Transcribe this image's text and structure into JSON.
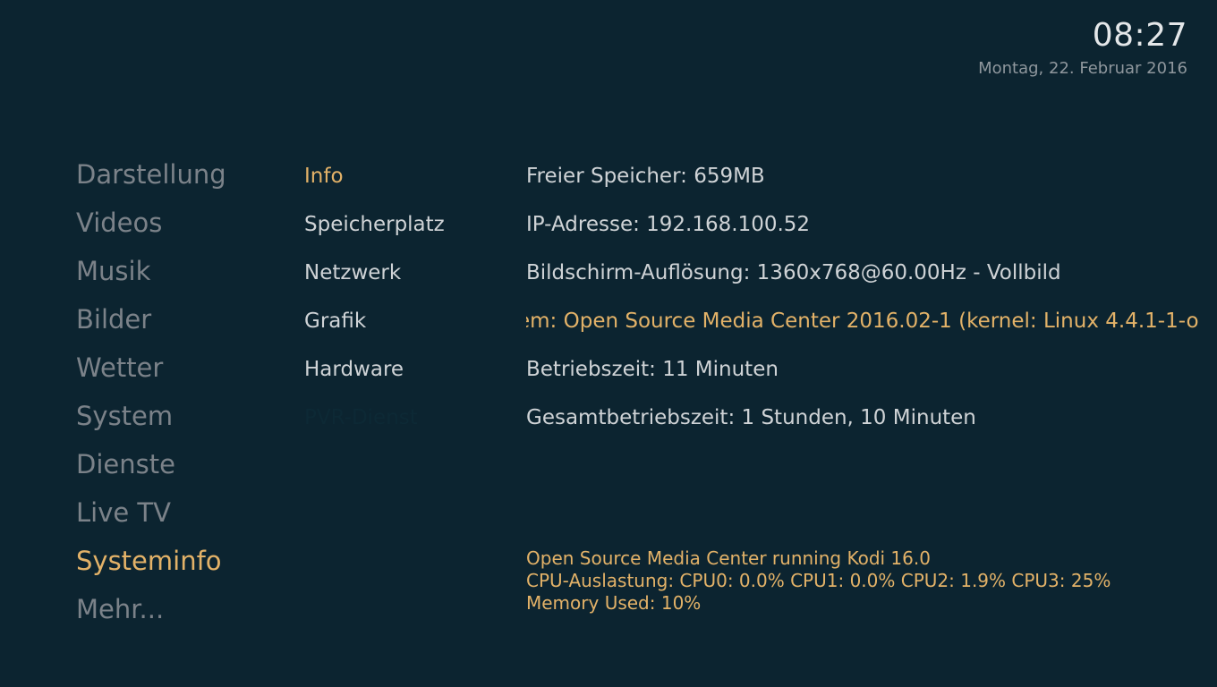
{
  "clock": {
    "time": "08:27",
    "date": "Montag, 22. Februar 2016"
  },
  "colors": {
    "background": "#0c2430",
    "accent": "#e3b268",
    "menu_text": "#7b8289",
    "info_text": "#cfd3d6",
    "disabled_text": "#0d2935",
    "date_text": "#8f979d",
    "time_text": "#e4e7e9"
  },
  "sidebar": {
    "items": [
      {
        "label": "Darstellung",
        "selected": false
      },
      {
        "label": "Videos",
        "selected": false
      },
      {
        "label": "Musik",
        "selected": false
      },
      {
        "label": "Bilder",
        "selected": false
      },
      {
        "label": "Wetter",
        "selected": false
      },
      {
        "label": "System",
        "selected": false
      },
      {
        "label": "Dienste",
        "selected": false
      },
      {
        "label": "Live TV",
        "selected": false
      },
      {
        "label": "Systeminfo",
        "selected": true
      },
      {
        "label": "Mehr...",
        "selected": false
      }
    ]
  },
  "subcategories": {
    "items": [
      {
        "label": "Info",
        "selected": true,
        "disabled": false
      },
      {
        "label": "Speicherplatz",
        "selected": false,
        "disabled": false
      },
      {
        "label": "Netzwerk",
        "selected": false,
        "disabled": false
      },
      {
        "label": "Grafik",
        "selected": false,
        "disabled": false
      },
      {
        "label": "Hardware",
        "selected": false,
        "disabled": false
      },
      {
        "label": "PVR-Dienst",
        "selected": false,
        "disabled": true
      }
    ]
  },
  "info_panel": {
    "rows": [
      {
        "text": "Freier Speicher: 659MB",
        "scrolling": false
      },
      {
        "text": "IP-Adresse: 192.168.100.52",
        "scrolling": false
      },
      {
        "text": "Bildschirm-Auflösung: 1360x768@60.00Hz - Vollbild",
        "scrolling": false
      },
      {
        "text": "em: Open Source Media Center 2016.02-1 (kernel: Linux 4.4.1-1-o",
        "scrolling": true
      },
      {
        "text": "Betriebszeit: 11 Minuten",
        "scrolling": false
      },
      {
        "text": "Gesamtbetriebszeit: 1 Stunden, 10 Minuten",
        "scrolling": false
      }
    ]
  },
  "status_block": {
    "lines": [
      "Open Source Media Center running Kodi 16.0",
      "CPU-Auslastung: CPU0: 0.0% CPU1: 0.0% CPU2: 1.9% CPU3:  25%",
      "Memory Used: 10%"
    ]
  }
}
